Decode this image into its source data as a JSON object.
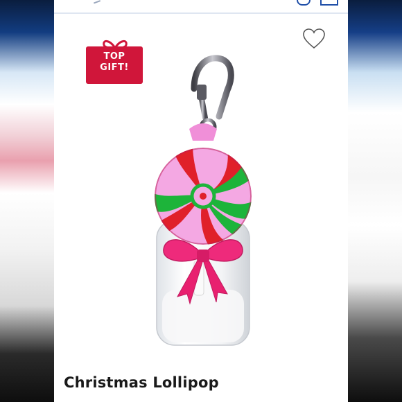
{
  "badge": {
    "line1": "TOP",
    "line2": "GIFT!",
    "color": "#d0163a"
  },
  "product": {
    "title": "Christmas Lollipop"
  },
  "icons": {
    "favorite": "heart-outline-icon",
    "gift": "gift-bow-icon"
  },
  "colors": {
    "accent": "#d0021b",
    "nav": "#1f4fa8"
  }
}
